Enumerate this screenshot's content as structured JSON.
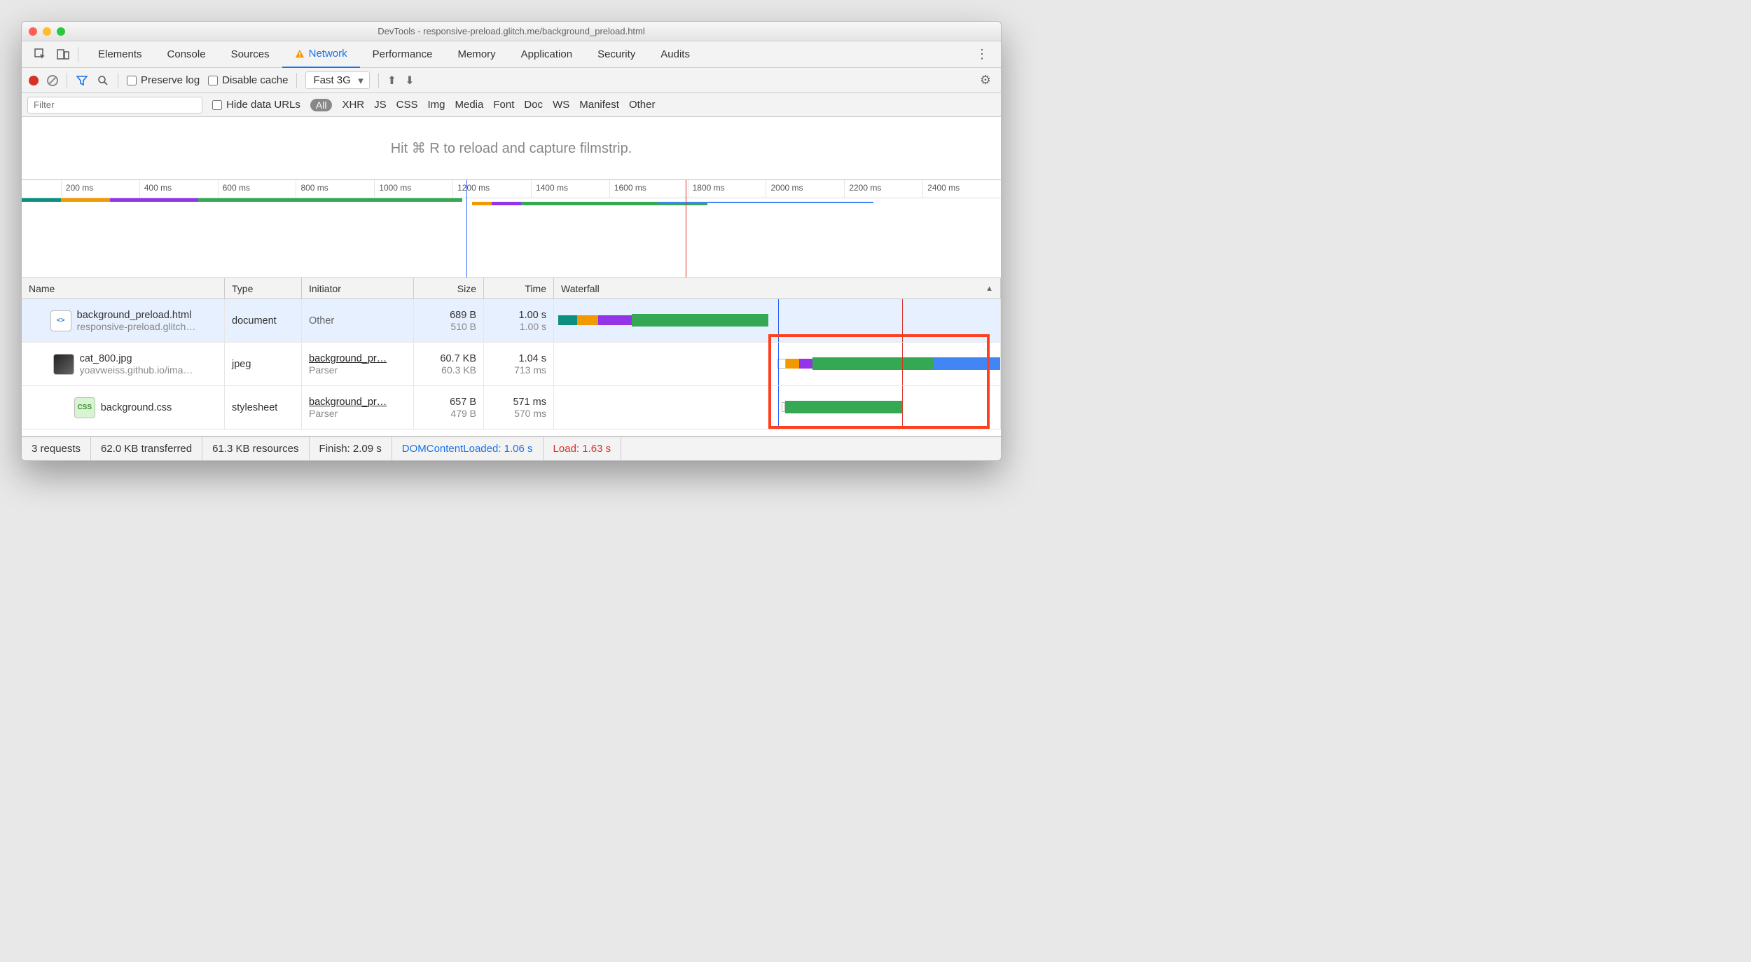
{
  "window": {
    "title": "DevTools - responsive-preload.glitch.me/background_preload.html"
  },
  "tabs": {
    "items": [
      {
        "label": "Elements"
      },
      {
        "label": "Console"
      },
      {
        "label": "Sources"
      },
      {
        "label": "Network"
      },
      {
        "label": "Performance"
      },
      {
        "label": "Memory"
      },
      {
        "label": "Application"
      },
      {
        "label": "Security"
      },
      {
        "label": "Audits"
      }
    ],
    "active_index": 3
  },
  "toolbar": {
    "preserve_log_label": "Preserve log",
    "disable_cache_label": "Disable cache",
    "throttling_value": "Fast 3G"
  },
  "filter": {
    "placeholder": "Filter",
    "hide_urls_label": "Hide data URLs",
    "types": [
      "All",
      "XHR",
      "JS",
      "CSS",
      "Img",
      "Media",
      "Font",
      "Doc",
      "WS",
      "Manifest",
      "Other"
    ]
  },
  "filmstrip_hint": "Hit ⌘ R to reload and capture filmstrip.",
  "timeline": {
    "ticks": [
      "200 ms",
      "400 ms",
      "600 ms",
      "800 ms",
      "1000 ms",
      "1200 ms",
      "1400 ms",
      "1600 ms",
      "1800 ms",
      "2000 ms",
      "2200 ms",
      "2400 ms"
    ]
  },
  "columns": {
    "name": "Name",
    "type": "Type",
    "initiator": "Initiator",
    "size": "Size",
    "time": "Time",
    "waterfall": "Waterfall"
  },
  "requests": [
    {
      "name": "background_preload.html",
      "sub": "responsive-preload.glitch…",
      "type": "document",
      "initiator": "Other",
      "initiator_sub": "",
      "size": "689 B",
      "size_sub": "510 B",
      "time": "1.00 s",
      "time_sub": "1.00 s",
      "icon": "html",
      "selected": true
    },
    {
      "name": "cat_800.jpg",
      "sub": "yoavweiss.github.io/ima…",
      "type": "jpeg",
      "initiator": "background_pr…",
      "initiator_sub": "Parser",
      "size": "60.7 KB",
      "size_sub": "60.3 KB",
      "time": "1.04 s",
      "time_sub": "713 ms",
      "icon": "img",
      "selected": false
    },
    {
      "name": "background.css",
      "sub": "",
      "type": "stylesheet",
      "initiator": "background_pr…",
      "initiator_sub": "Parser",
      "size": "657 B",
      "size_sub": "479 B",
      "time": "571 ms",
      "time_sub": "570 ms",
      "icon": "css",
      "selected": false
    }
  ],
  "status": {
    "requests": "3 requests",
    "transferred": "62.0 KB transferred",
    "resources": "61.3 KB resources",
    "finish": "Finish: 2.09 s",
    "dcl": "DOMContentLoaded: 1.06 s",
    "load": "Load: 1.63 s"
  }
}
